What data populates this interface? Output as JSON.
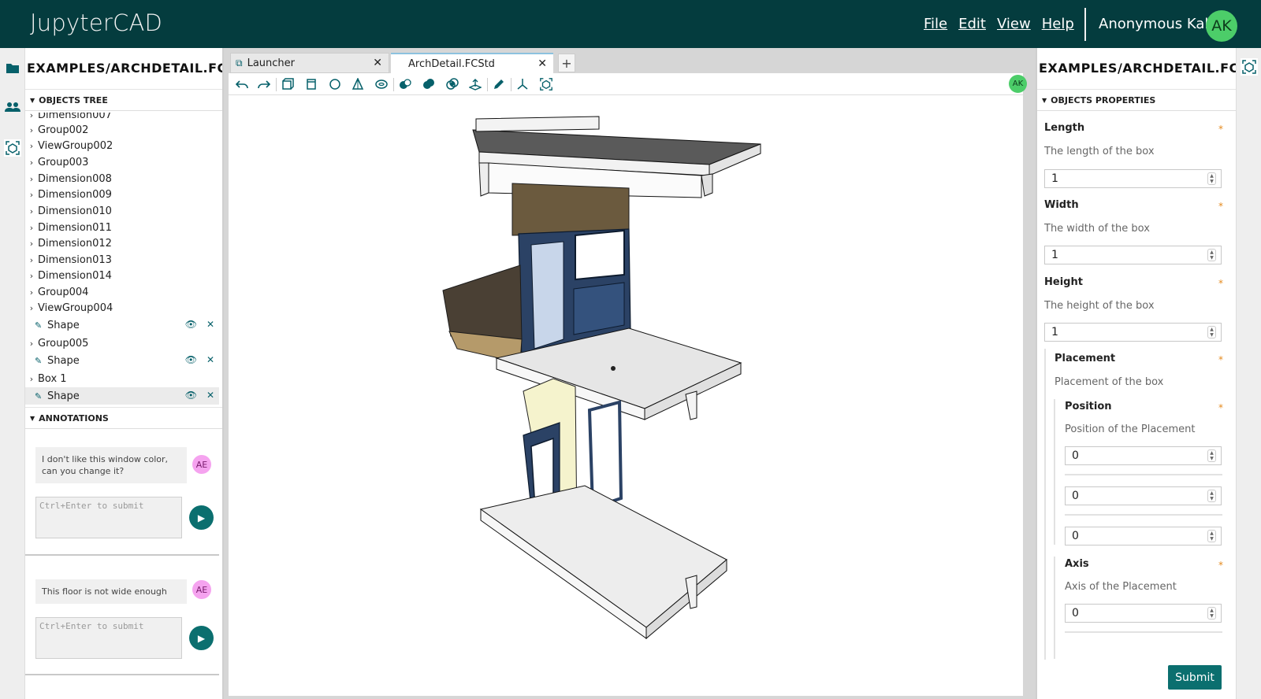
{
  "app": {
    "logo": "JupyterCAD",
    "menu": [
      "File",
      "Edit",
      "View",
      "Help"
    ],
    "user_name": "Anonymous Kale",
    "user_initials": "AK"
  },
  "left_panel": {
    "title": "EXAMPLES/ARCHDETAIL.FCST",
    "objects_tree_header": "OBJECTS TREE",
    "tree_items": [
      {
        "label": "Dimension007",
        "type": "group"
      },
      {
        "label": "Group002",
        "type": "group"
      },
      {
        "label": "ViewGroup002",
        "type": "group"
      },
      {
        "label": "Group003",
        "type": "group"
      },
      {
        "label": "Dimension008",
        "type": "group"
      },
      {
        "label": "Dimension009",
        "type": "group"
      },
      {
        "label": "Dimension010",
        "type": "group"
      },
      {
        "label": "Dimension011",
        "type": "group"
      },
      {
        "label": "Dimension012",
        "type": "group"
      },
      {
        "label": "Dimension013",
        "type": "group"
      },
      {
        "label": "Dimension014",
        "type": "group"
      },
      {
        "label": "Group004",
        "type": "group"
      },
      {
        "label": "ViewGroup004",
        "type": "group"
      },
      {
        "label": "Shape",
        "type": "leaf"
      },
      {
        "label": "Group005",
        "type": "group"
      },
      {
        "label": "Shape",
        "type": "leaf"
      },
      {
        "label": "Box 1",
        "type": "group"
      },
      {
        "label": "Shape",
        "type": "leaf",
        "selected": true
      }
    ],
    "annotations_header": "ANNOTATIONS",
    "annotations": [
      {
        "message": "I don't like this window color, can you change it?",
        "author_initials": "AE",
        "input_placeholder": "Ctrl+Enter to submit"
      },
      {
        "message": "This floor is not wide enough",
        "author_initials": "AE",
        "input_placeholder": "Ctrl+Enter to submit"
      }
    ]
  },
  "tabs": [
    {
      "label": "Launcher",
      "active": false
    },
    {
      "label": "ArchDetail.FCStd",
      "active": true
    }
  ],
  "toolbar": {
    "collaborator_initials": "AK"
  },
  "right_panel": {
    "title": "EXAMPLES/ARCHDETAIL.FCST",
    "properties_header": "OBJECTS PROPERTIES",
    "length": {
      "label": "Length",
      "description": "The length of the box",
      "value": "1"
    },
    "width": {
      "label": "Width",
      "description": "The width of the box",
      "value": "1"
    },
    "height": {
      "label": "Height",
      "description": "The height of the box",
      "value": "1"
    },
    "placement": {
      "label": "Placement",
      "description": "Placement of the box"
    },
    "position": {
      "label": "Position",
      "description": "Position of the Placement",
      "values": [
        "0",
        "0",
        "0"
      ]
    },
    "axis": {
      "label": "Axis",
      "description": "Axis of the Placement",
      "values": [
        "0"
      ]
    },
    "required_mark": "*",
    "submit_label": "Submit"
  },
  "colors": {
    "topbar": "#043c3e",
    "accent": "#0b6f6f",
    "user_avatar": "#4ccd69",
    "annotation_avatar": "#f5a3ef",
    "required": "#e48a1e"
  }
}
